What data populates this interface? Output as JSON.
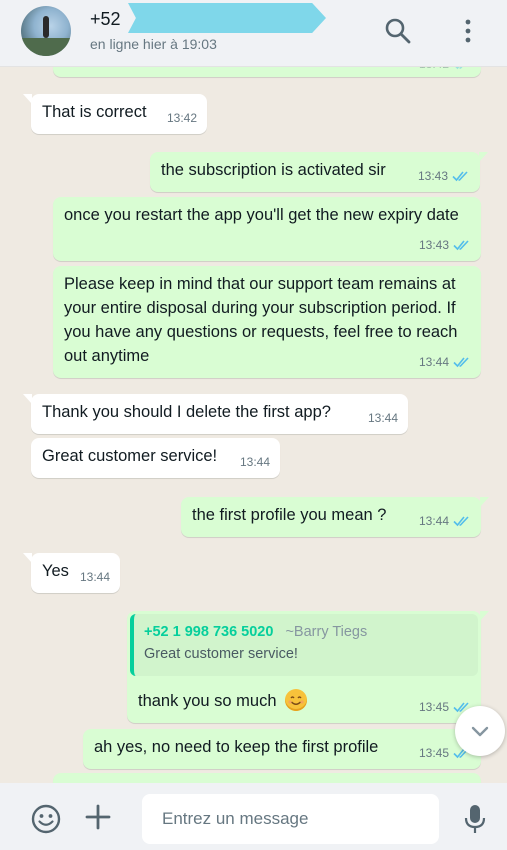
{
  "header": {
    "contact_name": "+52",
    "status": "en ligne hier à 19:03",
    "icons": [
      "search-icon",
      "menu-icon"
    ]
  },
  "colors": {
    "incoming": "#ffffff",
    "outgoing": "#d9fdd3",
    "read_ticks": "#53bdeb",
    "quote_accent": "#06cf9c",
    "background": "#efeae2"
  },
  "messages": [
    {
      "dir": "out",
      "text": "",
      "time": "13:42"
    },
    {
      "dir": "in",
      "text": "That is correct",
      "time": "13:42"
    },
    {
      "dir": "out",
      "text": "the subscription is activated sir",
      "time": "13:43"
    },
    {
      "dir": "out",
      "text": "once you restart the app you'll get the new expiry date",
      "time": "13:43"
    },
    {
      "dir": "out",
      "text": "Please keep in mind that our support team remains at your entire disposal during your subscription period. If you have any questions or requests, feel free to reach out anytime",
      "time": "13:44"
    },
    {
      "dir": "in",
      "text": "Thank you should I delete the first app?",
      "time": "13:44"
    },
    {
      "dir": "in",
      "text": "Great customer service!",
      "time": "13:44"
    },
    {
      "dir": "out",
      "text": "the first profile you mean ?",
      "time": "13:44"
    },
    {
      "dir": "in",
      "text": "Yes",
      "time": "13:44"
    },
    {
      "dir": "out",
      "text": "thank you so much",
      "time": "13:45",
      "emoji": "smiling-face-emoji",
      "quote": {
        "phone": "+52 1 998 736 5020",
        "author": "~Barry Tiegs",
        "text": "Great customer service!"
      }
    },
    {
      "dir": "out",
      "text": "ah yes, no need to keep the first profile",
      "time": "13:45"
    }
  ],
  "composer": {
    "placeholder": "Entrez un message",
    "icons": [
      "emoji-icon",
      "plus-icon",
      "mic-icon"
    ]
  },
  "scroll_down_icon": "chevron-down-icon"
}
